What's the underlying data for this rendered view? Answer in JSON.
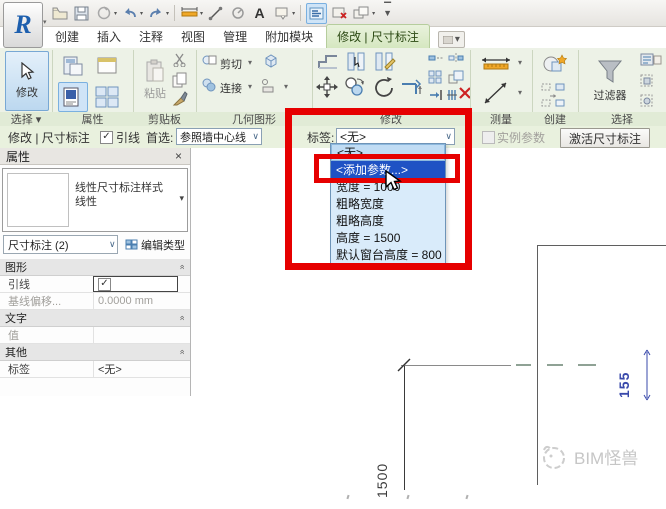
{
  "app": {
    "qat_icons": [
      "open-file-icon",
      "save-icon",
      "sync-icon",
      "undo-icon",
      "redo-icon",
      "dimension-icon",
      "measure-icon",
      "spot-elevation-icon",
      "text-icon",
      "tag-icon",
      "section-box-icon",
      "close-inactive-icon",
      "switch-windows-icon",
      "customize-qat-icon"
    ],
    "logo": "R"
  },
  "tabs": {
    "items": [
      "创建",
      "插入",
      "注释",
      "视图",
      "管理",
      "附加模块"
    ],
    "active": "修改 | 尺寸标注"
  },
  "ribbon": {
    "select_panel": {
      "modify_button": "修改",
      "label": "选择 ▾"
    },
    "properties_panel": {
      "label": "属性"
    },
    "clipboard_panel": {
      "label": "剪贴板",
      "paste": "粘贴"
    },
    "geometry_panel": {
      "label": "几何图形",
      "cut": "剪切",
      "join": "连接"
    },
    "modify_panel": {
      "label": "修改"
    },
    "measure_panel": {
      "label": "测量"
    },
    "create_panel": {
      "label": "创建"
    },
    "selection_panel": {
      "label": "选择",
      "filter": "过滤器"
    }
  },
  "options_bar": {
    "context": "修改 | 尺寸标注",
    "leader_label": "引线",
    "prefer_label": "首选:",
    "prefer_value": "参照墙中心线",
    "tag_label": "标签:",
    "tag_value": "<无>",
    "instance_param_label": "实例参数",
    "activate_button": "激活尺寸标注"
  },
  "dropdown": {
    "items": [
      "<无>",
      "<添加参数...>",
      "宽度 = 1000",
      "粗略宽度",
      "粗略高度",
      "高度 = 1500",
      "默认窗台高度 = 800"
    ],
    "highlighted": "<添加参数...>"
  },
  "properties": {
    "title": "属性",
    "close": "×",
    "type_name": "线性尺寸标注样式",
    "type_sub": "线性",
    "instance_selector": "尺寸标注 (2)",
    "edit_type": "编辑类型",
    "sections": [
      {
        "name": "图形",
        "rows": [
          {
            "label": "引线",
            "value": "",
            "checkbox": true
          },
          {
            "label": "基线偏移...",
            "value": "0.0000 mm"
          }
        ]
      },
      {
        "name": "文字",
        "rows": [
          {
            "label": "值",
            "value": ""
          }
        ]
      },
      {
        "name": "其他",
        "rows": [
          {
            "label": "标签",
            "value": "<无>"
          }
        ]
      }
    ]
  },
  "drawing": {
    "dim_155": "155",
    "dim_1500": "1500",
    "watermark": "BIM怪兽"
  },
  "colors": {
    "annotation_red": "#e60000",
    "highlight_blue": "#1f52c4",
    "ribbon_green": "#edf2e7",
    "dim_blue": "#3949ab"
  }
}
